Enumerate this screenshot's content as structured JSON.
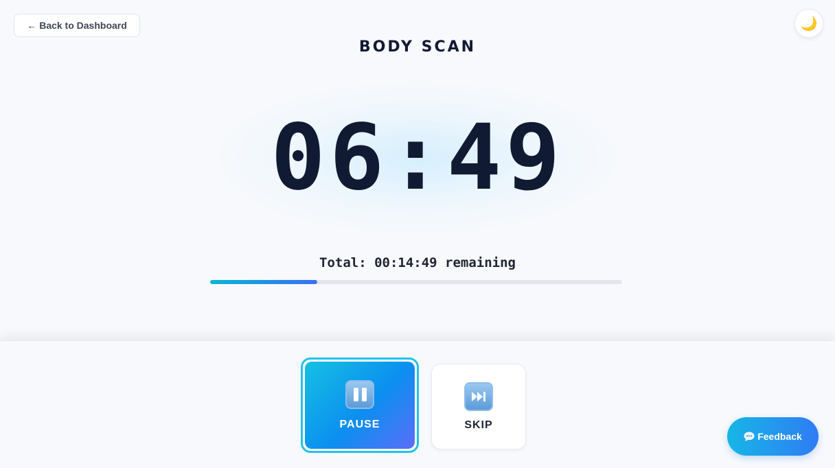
{
  "nav": {
    "back_arrow": "←",
    "back_label": "Back to Dashboard"
  },
  "theme_toggle": {
    "icon": "moon-icon",
    "glyph": "🌙"
  },
  "session": {
    "title": "BODY SCAN",
    "timer": "06:49",
    "total_text": "Total: 00:14:49 remaining",
    "progress_fraction": 0.26
  },
  "controls": {
    "pause_label": "PAUSE",
    "pause_icon": "pause-icon",
    "skip_label": "SKIP",
    "skip_icon": "skip-forward-icon"
  },
  "feedback": {
    "label": "Feedback",
    "icon": "chat-bubble-icon"
  },
  "colors": {
    "accent_start": "#06b6d4",
    "accent_end": "#3b6ef6",
    "text_dark": "#111a33"
  }
}
